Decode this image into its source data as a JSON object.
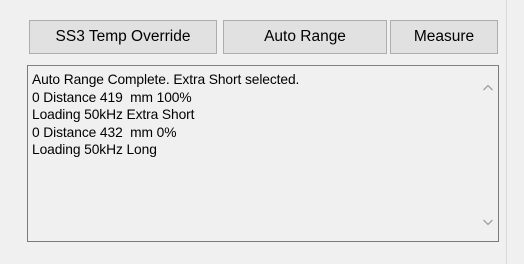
{
  "buttons": {
    "ss3_temp_override": "SS3 Temp Override",
    "auto_range": "Auto Range",
    "measure": "Measure"
  },
  "log": {
    "lines": [
      "Auto Range Complete. Extra Short selected.",
      "0 Distance 419  mm 100%",
      "Loading 50kHz Extra Short",
      "0 Distance 432  mm 0%",
      "Loading 50kHz Long"
    ]
  },
  "icons": {
    "scroll_up": "chevron-up-icon",
    "scroll_down": "chevron-down-icon"
  },
  "colors": {
    "background": "#f0f0f0",
    "button_face": "#e1e1e1",
    "button_border": "#adadad",
    "textbox_border": "#7a7a7a",
    "scroll_arrow": "#a0a0a0"
  }
}
